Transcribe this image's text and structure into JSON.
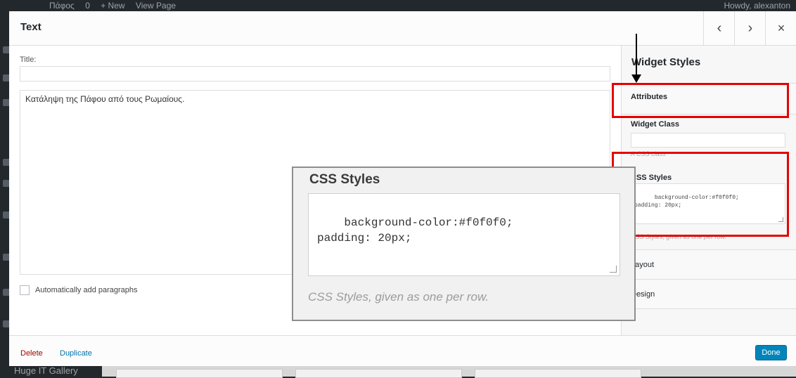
{
  "admin_bar": {
    "site_name": "Πάφος",
    "comments_count": "0",
    "new_label": "+ New",
    "view_page_label": "View Page",
    "howdy": "Howdy, alexanton"
  },
  "admin_menu": {
    "bottom_item": "Huge IT Gallery"
  },
  "modal": {
    "title": "Text",
    "prev_icon": "‹",
    "next_icon": "›",
    "close_icon": "×"
  },
  "widget_form": {
    "title_label": "Title:",
    "title_value": "",
    "content": "Κατάληψη της Πάφου από τους Ρωμαίους.",
    "auto_paragraphs_label": "Automatically add paragraphs",
    "auto_paragraphs_checked": false
  },
  "widget_styles": {
    "heading": "Widget Styles",
    "attributes_label": "Attributes",
    "widget_class_label": "Widget Class",
    "widget_class_value": "",
    "widget_class_desc": "A CSS class",
    "css_styles_label": "CSS Styles",
    "css_styles_value": "background-color:#f0f0f0;\npadding: 20px;",
    "css_styles_desc": "CSS Styles, given as one per row.",
    "layout_label": "Layout",
    "design_label": "Design"
  },
  "footer": {
    "delete_label": "Delete",
    "duplicate_label": "Duplicate",
    "done_label": "Done"
  },
  "zoom_callout": {
    "title": "CSS Styles",
    "css_text": "background-color:#f0f0f0;\npadding: 20px;",
    "description": "CSS Styles, given as one per row."
  },
  "colors": {
    "primary_button": "#0085ba",
    "delete_link": "#a00",
    "duplicate_link": "#0073aa",
    "highlight": "#e60000"
  }
}
